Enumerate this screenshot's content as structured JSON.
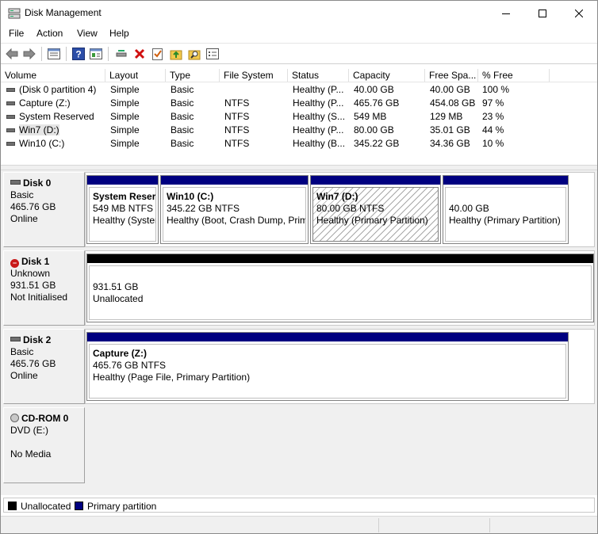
{
  "window": {
    "title": "Disk Management",
    "icon": "disk-management-icon"
  },
  "menu": [
    "File",
    "Action",
    "View",
    "Help"
  ],
  "toolbar": [
    "back-arrow-icon",
    "forward-arrow-icon",
    "list-view-icon",
    "help-icon",
    "properties-icon",
    "connect-disk-icon",
    "delete-icon",
    "check-icon",
    "up-folder-icon",
    "search-icon",
    "settings-list-icon"
  ],
  "volume_list": {
    "headers": [
      "Volume",
      "Layout",
      "Type",
      "File System",
      "Status",
      "Capacity",
      "Free Spa...",
      "% Free"
    ],
    "rows": [
      [
        "(Disk 0 partition 4)",
        "Simple",
        "Basic",
        "",
        "Healthy (P...",
        "40.00 GB",
        "40.00 GB",
        "100 %"
      ],
      [
        "Capture (Z:)",
        "Simple",
        "Basic",
        "NTFS",
        "Healthy (P...",
        "465.76 GB",
        "454.08 GB",
        "97 %"
      ],
      [
        "System Reserved",
        "Simple",
        "Basic",
        "NTFS",
        "Healthy (S...",
        "549 MB",
        "129 MB",
        "23 %"
      ],
      [
        "Win7 (D:)",
        "Simple",
        "Basic",
        "NTFS",
        "Healthy (P...",
        "80.00 GB",
        "35.01 GB",
        "44 %"
      ],
      [
        "Win10 (C:)",
        "Simple",
        "Basic",
        "NTFS",
        "Healthy (B...",
        "345.22 GB",
        "34.36 GB",
        "10 %"
      ]
    ]
  },
  "disks": [
    {
      "name": "Disk 0",
      "type": "Basic",
      "size": "465.76 GB",
      "state": "Online",
      "partitions": [
        {
          "name": "System Reser",
          "size": "549 MB NTFS",
          "status": "Healthy (Syster"
        },
        {
          "name": "Win10  (C:)",
          "size": "345.22 GB NTFS",
          "status": "Healthy (Boot, Crash Dump, Prim"
        },
        {
          "name": "Win7  (D:)",
          "size": "80.00 GB NTFS",
          "status": "Healthy (Primary Partition)"
        },
        {
          "name": "",
          "size": "40.00 GB",
          "status": "Healthy (Primary Partition)"
        }
      ]
    },
    {
      "name": "Disk 1",
      "type": "Unknown",
      "size": "931.51 GB",
      "state": "Not Initialised",
      "partitions": [
        {
          "name": "",
          "size": "931.51 GB",
          "status": "Unallocated"
        }
      ]
    },
    {
      "name": "Disk 2",
      "type": "Basic",
      "size": "465.76 GB",
      "state": "Online",
      "partitions": [
        {
          "name": "Capture  (Z:)",
          "size": "465.76 GB NTFS",
          "status": "Healthy (Page File, Primary Partition)"
        }
      ]
    },
    {
      "name": "CD-ROM 0",
      "type": "DVD (E:)",
      "size": "",
      "state": "No Media",
      "partitions": []
    }
  ],
  "legend": [
    {
      "label": "Unallocated",
      "color": "#000000"
    },
    {
      "label": "Primary partition",
      "color": "#000080"
    }
  ]
}
